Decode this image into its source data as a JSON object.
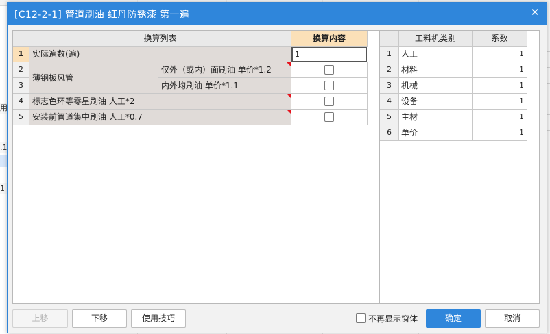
{
  "dialog": {
    "title": "[C12-2-1] 管道刷油 红丹防锈漆 第一遍",
    "close": "✕"
  },
  "conversion_table": {
    "header_list": "换算列表",
    "header_content": "换算内容",
    "rows": [
      {
        "num": "1",
        "label": "实际遍数(遍)",
        "value": "1"
      },
      {
        "num": "2",
        "label": "薄钢板风管",
        "sub": "仅外（或内）面刷油 单价*1.2"
      },
      {
        "num": "3",
        "sub": "内外均刷油 单价*1.1"
      },
      {
        "num": "4",
        "label": "标志色环等零星刷油 人工*2"
      },
      {
        "num": "5",
        "label": "安装前管道集中刷油 人工*0.7"
      }
    ]
  },
  "coef_table": {
    "header_type": "工料机类别",
    "header_coef": "系数",
    "rows": [
      {
        "num": "1",
        "type": "人工",
        "coef": "1"
      },
      {
        "num": "2",
        "type": "材料",
        "coef": "1"
      },
      {
        "num": "3",
        "type": "机械",
        "coef": "1"
      },
      {
        "num": "4",
        "type": "设备",
        "coef": "1"
      },
      {
        "num": "5",
        "type": "主材",
        "coef": "1"
      },
      {
        "num": "6",
        "type": "单价",
        "coef": "1"
      }
    ]
  },
  "buttons": {
    "move_up": "上移",
    "move_down": "下移",
    "tips": "使用技巧",
    "dont_show": "不再显示窗体",
    "ok": "确定",
    "cancel": "取消"
  },
  "background": {
    "left_stubs": [
      "用",
      ".1",
      "1"
    ]
  },
  "colors": {
    "title_bar": "#2f86db",
    "header_highlight": "#fbe0b8",
    "gray_cell": "#e0dbd8",
    "red_marker": "#e5141e"
  }
}
